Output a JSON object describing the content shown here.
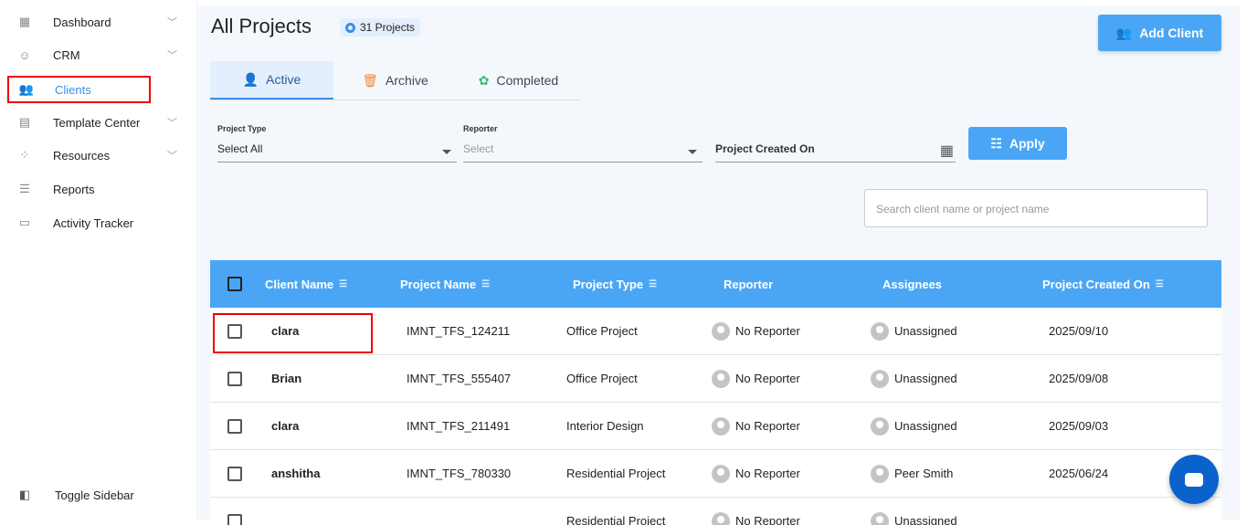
{
  "sidebar": {
    "items": [
      {
        "label": "Dashboard",
        "icon": "dashboard-icon"
      },
      {
        "label": "CRM",
        "icon": "crm-icon"
      },
      {
        "label": "Clients",
        "icon": "clients-icon"
      },
      {
        "label": "Template Center",
        "icon": "template-icon"
      },
      {
        "label": "Resources",
        "icon": "resources-icon"
      },
      {
        "label": "Reports",
        "icon": "reports-icon"
      },
      {
        "label": "Activity Tracker",
        "icon": "activity-icon"
      }
    ],
    "toggle": "Toggle Sidebar"
  },
  "header": {
    "title": "All Projects",
    "count": "31 Projects",
    "add_client": "Add Client"
  },
  "tabs": [
    "Active",
    "Archive",
    "Completed"
  ],
  "filters": {
    "project_type_label": "Project Type",
    "project_type_value": "Select All",
    "reporter_label": "Reporter",
    "reporter_placeholder": "Select",
    "created_on_label": "Project Created On",
    "apply": "Apply"
  },
  "search": {
    "placeholder": "Search client name or project name"
  },
  "table": {
    "headers": [
      "Client Name",
      "Project Name",
      "Project Type",
      "Reporter",
      "Assignees",
      "Project Created On"
    ],
    "rows": [
      [
        "clara",
        "IMNT_TFS_124211",
        "Office Project",
        "No Reporter",
        "Unassigned",
        "2025/09/10"
      ],
      [
        "Brian",
        "IMNT_TFS_555407",
        "Office Project",
        "No Reporter",
        "Unassigned",
        "2025/09/08"
      ],
      [
        "clara",
        "IMNT_TFS_211491",
        "Interior Design",
        "No Reporter",
        "Unassigned",
        "2025/09/03"
      ],
      [
        "anshitha",
        "IMNT_TFS_780330",
        "Residential Project",
        "No Reporter",
        "Peer Smith",
        "2025/06/24"
      ],
      [
        "",
        "",
        "Residential Project",
        "No Reporter",
        "Unassigned",
        ""
      ]
    ]
  }
}
